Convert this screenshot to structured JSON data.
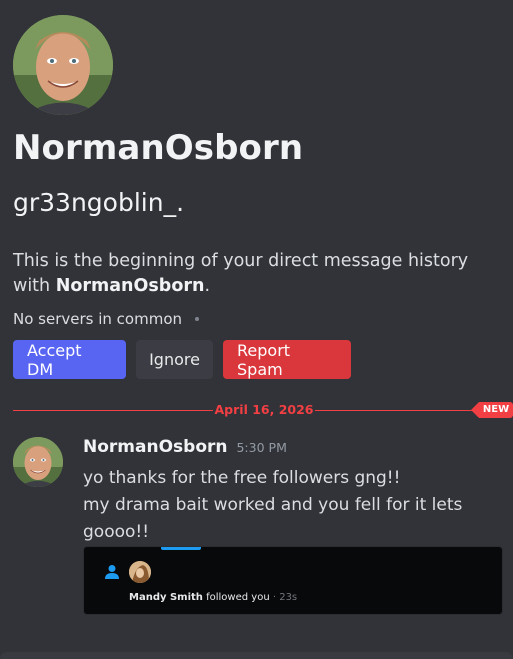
{
  "profile": {
    "display_name": "NormanOsborn",
    "username": "gr33ngoblin_."
  },
  "intro": {
    "text": "This is the beginning of your direct message history with ",
    "name": "NormanOsborn",
    "suffix": "."
  },
  "mutual": {
    "text": "No servers in common"
  },
  "actions": {
    "accept_label": "Accept DM",
    "ignore_label": "Ignore",
    "spam_label": "Report Spam"
  },
  "divider": {
    "date": "April 16, 2026",
    "badge": "NEW"
  },
  "message": {
    "author": "NormanOsborn",
    "time": "5:30 PM",
    "line1": "yo thanks for the free followers gng!!",
    "line2": "my drama bait worked and you fell for it lets goooo!!"
  },
  "embed": {
    "follower_name": "Mandy Smith",
    "action": " followed you",
    "ago": " · 23s"
  },
  "colors": {
    "background": "#313338",
    "accept": "#5865f2",
    "ignore": "#3c3d44",
    "spam": "#da373c",
    "new_divider": "#f23f43",
    "embed_accent": "#1d9bf0"
  },
  "icons": {
    "follow": "person-icon"
  }
}
